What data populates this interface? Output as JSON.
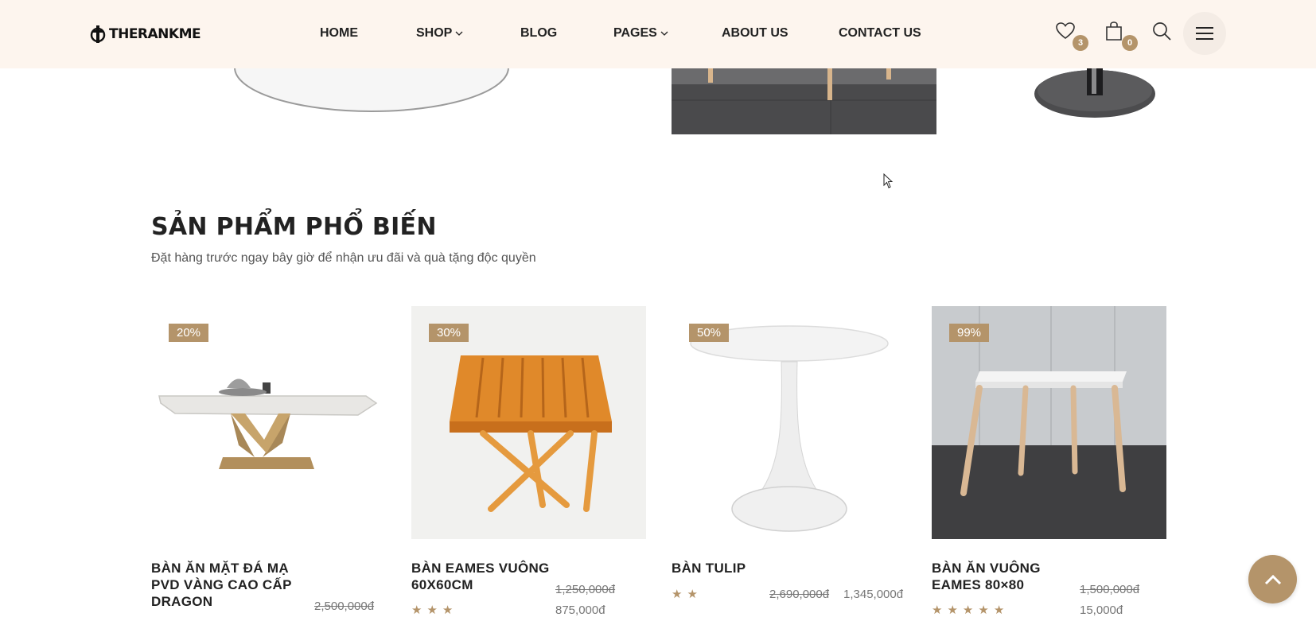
{
  "header": {
    "logo_text": "THERANKME",
    "nav": [
      {
        "label": "HOME",
        "has_dropdown": false
      },
      {
        "label": "SHOP",
        "has_dropdown": true
      },
      {
        "label": "BLOG",
        "has_dropdown": false
      },
      {
        "label": "PAGES",
        "has_dropdown": true
      },
      {
        "label": "ABOUT US",
        "has_dropdown": false
      },
      {
        "label": "CONTACT US",
        "has_dropdown": false
      }
    ],
    "wishlist_count": "3",
    "cart_count": "0",
    "icons": [
      "heart-icon",
      "shopping-bag-icon",
      "search-icon",
      "hamburger-menu-icon"
    ]
  },
  "section": {
    "title": "SẢN PHẨM PHỔ BIẾN",
    "subtitle": "Đặt hàng trước ngay bây giờ để nhận ưu đãi và quà tặng độc quyền"
  },
  "products": [
    {
      "name": "BÀN ĂN MẶT ĐÁ MẠ PVD VÀNG CAO CẤP DRAGON",
      "discount": "20%",
      "old_price": "2,500,000đ",
      "new_price": "",
      "rating": 0
    },
    {
      "name": "BÀN EAMES VUÔNG 60X60CM",
      "discount": "30%",
      "old_price": "1,250,000đ",
      "new_price": "875,000đ",
      "rating": 3
    },
    {
      "name": "BÀN TULIP",
      "discount": "50%",
      "old_price": "2,690,000đ",
      "new_price": "1,345,000đ",
      "rating": 2
    },
    {
      "name": "BÀN ĂN VUÔNG EAMES 80×80",
      "discount": "99%",
      "old_price": "1,500,000đ",
      "new_price": "15,000đ",
      "rating": 5
    }
  ],
  "colors": {
    "accent": "#b4946a",
    "header_bg": "#fdf5ee",
    "text": "#222222"
  }
}
